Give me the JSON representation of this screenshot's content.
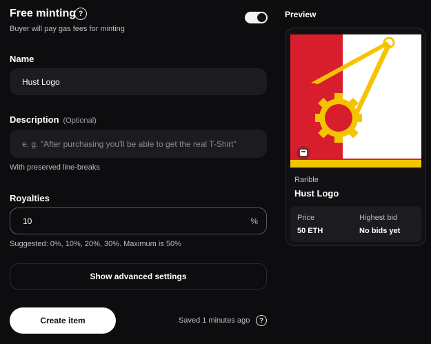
{
  "free_minting": {
    "title": "Free minting",
    "help_icon": "?",
    "subtitle": "Buyer will pay gas fees for minting",
    "toggle_on": true
  },
  "name": {
    "label": "Name",
    "value": "Hust Logo"
  },
  "description": {
    "label": "Description",
    "optional": "(Optional)",
    "placeholder": "e. g. \"After purchasing you'll be able to get the real T-Shirt\"",
    "hint": "With preserved line-breaks"
  },
  "royalties": {
    "label": "Royalties",
    "value": "10",
    "unit": "%",
    "hint": "Suggested: 0%, 10%, 20%, 30%. Maximum is 50%"
  },
  "advanced_button": "Show advanced settings",
  "create_button": "Create item",
  "saved_text": "Saved 1 minutes ago",
  "saved_help": "?",
  "preview": {
    "heading": "Preview",
    "collection": "Rarible",
    "item_name": "Hust Logo",
    "price_label": "Price",
    "price_value": "50 ETH",
    "bid_label": "Highest bid",
    "bid_value": "No bids yet"
  },
  "colors": {
    "accent_red": "#d81e2c",
    "accent_yellow": "#f5c400"
  }
}
